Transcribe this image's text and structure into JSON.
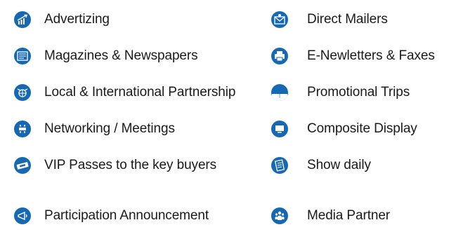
{
  "left_items": [
    {
      "label": "Advertizing",
      "icon": "bar-chart-icon"
    },
    {
      "label": "Magazines & Newspapers",
      "icon": "newspaper-icon"
    },
    {
      "label": "Local & International Partnership",
      "icon": "globe-partnership-icon"
    },
    {
      "label": "Networking / Meetings",
      "icon": "meeting-table-icon"
    },
    {
      "label": "VIP Passes to the key buyers",
      "icon": "ticket-icon"
    },
    {
      "label": "Participation Announcement",
      "icon": "megaphone-icon"
    }
  ],
  "right_items": [
    {
      "label": "Direct Mailers",
      "icon": "envelope-icon"
    },
    {
      "label": "E-Newletters & Faxes",
      "icon": "fax-icon"
    },
    {
      "label": "Promotional Trips",
      "icon": "umbrella-icon"
    },
    {
      "label": "Composite Display",
      "icon": "monitor-icon"
    },
    {
      "label": "Show daily",
      "icon": "newsletter-icon"
    },
    {
      "label": "Media Partner",
      "icon": "people-icon"
    }
  ],
  "colors": {
    "icon_bg": "#1668b3",
    "text": "#1a1a1a"
  }
}
